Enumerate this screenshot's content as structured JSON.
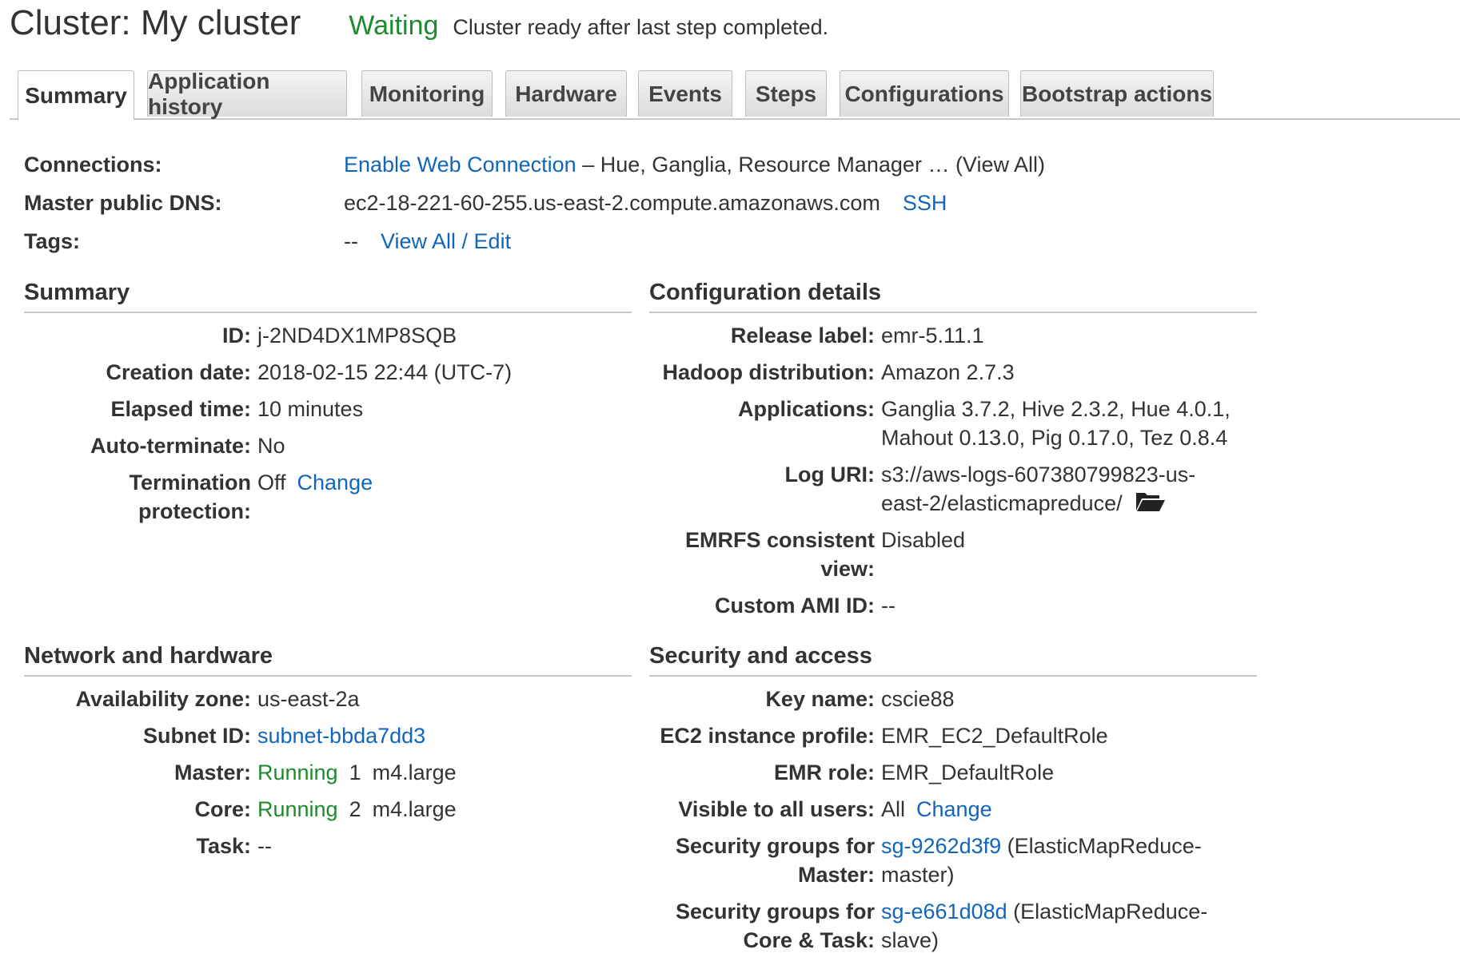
{
  "header": {
    "title": "Cluster: My cluster",
    "state": "Waiting",
    "state_message": "Cluster ready after last step completed."
  },
  "tabs": [
    {
      "label": "Summary"
    },
    {
      "label": "Application history"
    },
    {
      "label": "Monitoring"
    },
    {
      "label": "Hardware"
    },
    {
      "label": "Events"
    },
    {
      "label": "Steps"
    },
    {
      "label": "Configurations"
    },
    {
      "label": "Bootstrap actions"
    }
  ],
  "top": {
    "connections": {
      "label": "Connections:",
      "link": "Enable Web Connection",
      "rest": " – Hue, Ganglia, Resource Manager … (View All)"
    },
    "dns": {
      "label": "Master public DNS:",
      "value": "ec2-18-221-60-255.us-east-2.compute.amazonaws.com",
      "ssh": "SSH"
    },
    "tags": {
      "label": "Tags:",
      "value": "--",
      "link": "View All / Edit"
    }
  },
  "summary": {
    "heading": "Summary",
    "id": {
      "label": "ID:",
      "value": "j-2ND4DX1MP8SQB"
    },
    "creation": {
      "label": "Creation date:",
      "value": "2018-02-15 22:44 (UTC-7)"
    },
    "elapsed": {
      "label": "Elapsed time:",
      "value": "10 minutes"
    },
    "autoterm": {
      "label": "Auto-terminate:",
      "value": "No"
    },
    "termination": {
      "label_line1": "Termination",
      "label_line2": "protection:",
      "value": "Off",
      "change": "Change"
    }
  },
  "config": {
    "heading": "Configuration details",
    "release": {
      "label": "Release label:",
      "value": "emr-5.11.1"
    },
    "hadoop": {
      "label": "Hadoop distribution:",
      "value": "Amazon 2.7.3"
    },
    "apps": {
      "label": "Applications:",
      "line1": "Ganglia 3.7.2, Hive 2.3.2, Hue 4.0.1,",
      "line2": "Mahout 0.13.0, Pig 0.17.0, Tez 0.8.4"
    },
    "log": {
      "label": "Log URI:",
      "line1": "s3://aws-logs-607380799823-us-",
      "line2": "east-2/elasticmapreduce/",
      "icon": "folder-open-icon"
    },
    "emrfs": {
      "label_line1": "EMRFS consistent",
      "label_line2": "view:",
      "value": "Disabled"
    },
    "ami": {
      "label": "Custom AMI ID:",
      "value": "--"
    }
  },
  "network": {
    "heading": "Network and hardware",
    "az": {
      "label": "Availability zone:",
      "value": "us-east-2a"
    },
    "subnet": {
      "label": "Subnet ID:",
      "value": "subnet-bbda7dd3"
    },
    "master": {
      "label": "Master:",
      "status": "Running",
      "count": "1",
      "type": "m4.large"
    },
    "core": {
      "label": "Core:",
      "status": "Running",
      "count": "2",
      "type": "m4.large"
    },
    "task": {
      "label": "Task:",
      "value": "--"
    }
  },
  "security": {
    "heading": "Security and access",
    "key": {
      "label": "Key name:",
      "value": "cscie88"
    },
    "profile": {
      "label": "EC2 instance profile:",
      "value": "EMR_EC2_DefaultRole"
    },
    "role": {
      "label": "EMR role:",
      "value": "EMR_DefaultRole"
    },
    "visible": {
      "label": "Visible to all users:",
      "value": "All",
      "change": "Change"
    },
    "sg_master": {
      "label_line1": "Security groups for",
      "label_line2": "Master:",
      "link": "sg-9262d3f9",
      "rest1": " (ElasticMapReduce-",
      "rest2": "master)"
    },
    "sg_core": {
      "label_line1": "Security groups for",
      "label_line2": "Core & Task:",
      "link": "sg-e661d08d",
      "rest1": " (ElasticMapReduce-",
      "rest2": "slave)"
    }
  },
  "colors": {
    "link": "#1166bb",
    "running": "#1d8a2e",
    "tab_border": "#bdbdbd"
  }
}
